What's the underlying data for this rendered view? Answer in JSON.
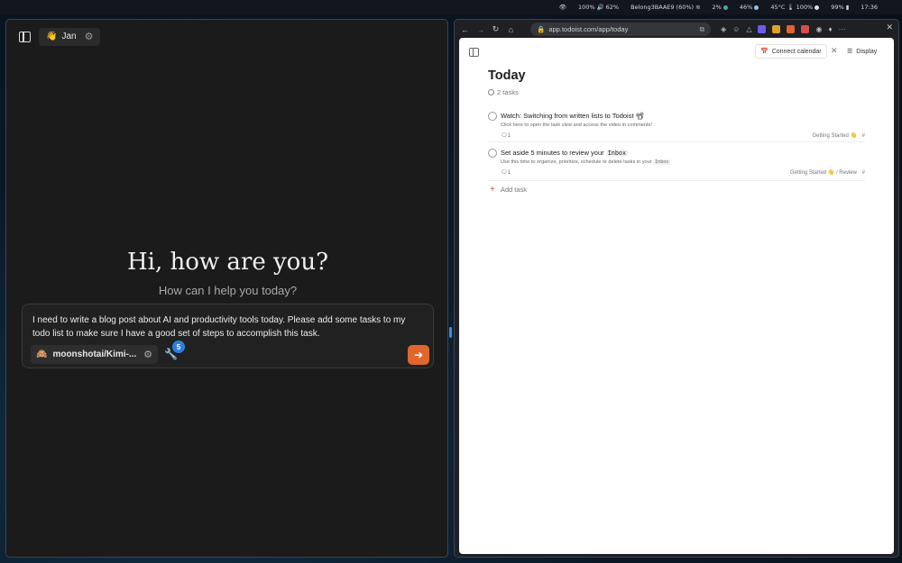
{
  "system_bar": {
    "items": [
      "100%",
      "62%",
      "Belong3BAAE9 (60%)",
      "2%",
      "46%",
      "45°C",
      "100%",
      "99%",
      "17:36"
    ]
  },
  "jan": {
    "assistant": {
      "emoji": "👋",
      "name": "Jan"
    },
    "greeting": "Hi, how are you?",
    "subgreeting": "How can I help you today?",
    "composer": {
      "text": "I need to write a blog post about AI and productivity tools today. Please add some tasks to my todo list to make sure I have a good set of steps to accomplish this task.",
      "model_emoji": "🙈",
      "model_name": "moonshotai/Kimi-...",
      "tools_count": "5"
    }
  },
  "browser": {
    "url": "app.todoist.com/app/today",
    "page": {
      "connect_calendar": "Connect calendar",
      "display": "Display",
      "title": "Today",
      "task_count": "2 tasks",
      "tasks": [
        {
          "title": "Watch: Switching from written lists to Todoist 📽",
          "desc": "Click here to open the task view and access the video in comments!",
          "comments": "1",
          "project": "Getting Started 👋"
        },
        {
          "title_prefix": "Set aside 5 minutes to review your",
          "title_code": "Inbox",
          "desc_prefix": "Use this time to organize, prioritize, schedule or delete tasks in your",
          "desc_code": "Inbox",
          "comments": "1",
          "project": "Getting Started 👋 / Review"
        }
      ],
      "add_task": "Add task"
    }
  },
  "colors": {
    "send_button": "#e0662e",
    "badge": "#2f7ee0",
    "todoist_red": "#dc4c3e"
  }
}
